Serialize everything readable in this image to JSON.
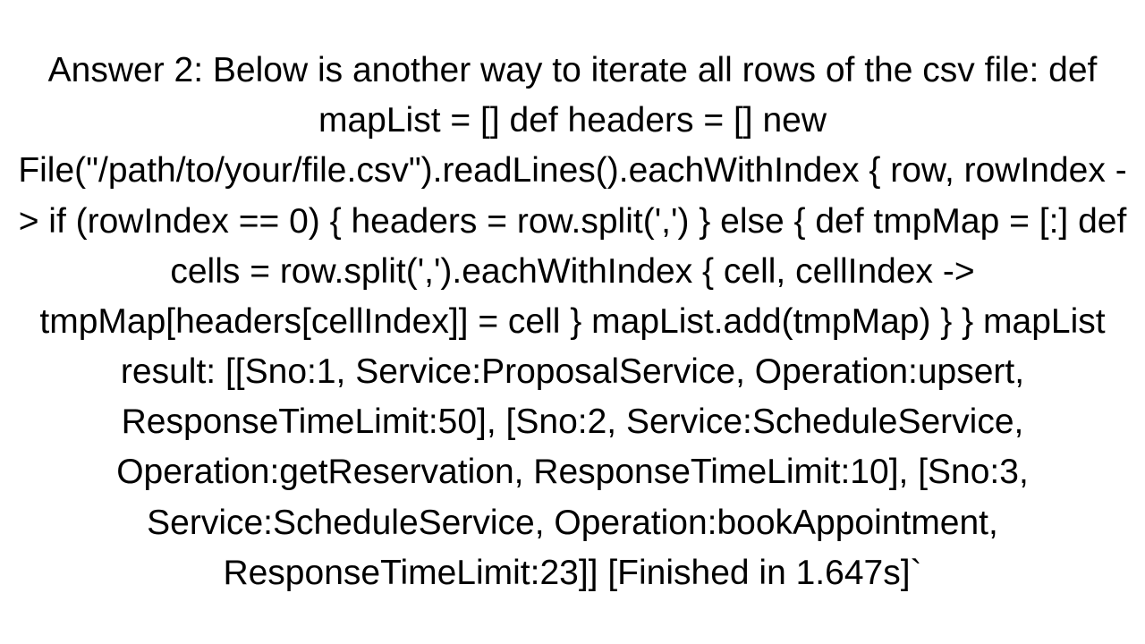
{
  "text": "Answer 2: Below is another way to iterate all rows of the csv file: def mapList = [] def headers = [] new File(\"/path/to/your/file.csv\").readLines().eachWithIndex { row, rowIndex ->     if (rowIndex == 0) { headers = row.split(',') }     else {         def tmpMap = [:]         def cells = row.split(',').eachWithIndex { cell, cellIndex ->             tmpMap[headers[cellIndex]] = cell         }         mapList.add(tmpMap)     } }  mapList result: [[Sno:1, Service:ProposalService, Operation:upsert, ResponseTimeLimit:50], [Sno:2, Service:ScheduleService, Operation:getReservation, ResponseTimeLimit:10], [Sno:3, Service:ScheduleService, Operation:bookAppointment, ResponseTimeLimit:23]] [Finished in 1.647s]`"
}
